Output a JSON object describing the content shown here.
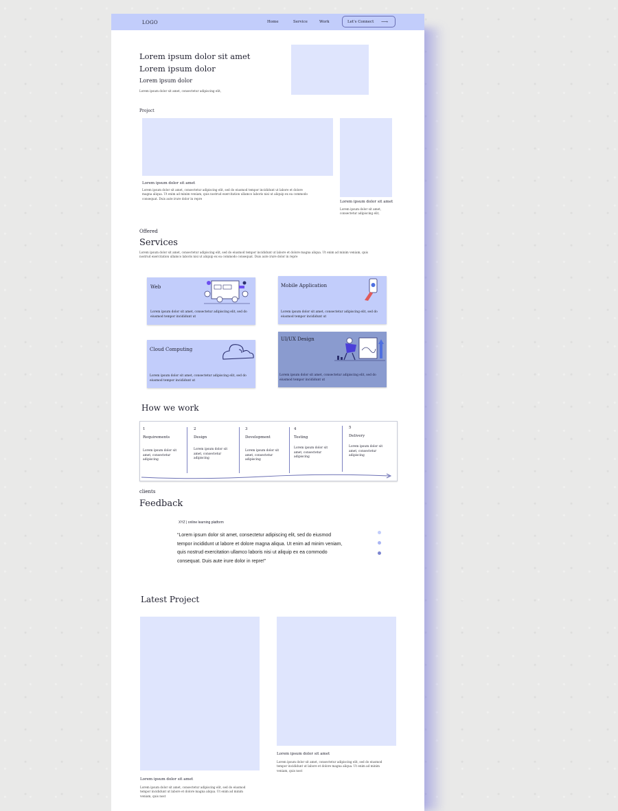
{
  "navbar": {
    "logo": "LOGO",
    "links": [
      "Home",
      "Service",
      "Work"
    ],
    "cta_label": "Let's  Connect",
    "cta_icon": "long-arrow-right-icon"
  },
  "hero": {
    "title1": "Lorem ipsum dolor sit amet",
    "title2": "Lorem ipsum dolor",
    "title3": "Lorem ipsum dolor",
    "body": "Lorem ipsum dolor sit amet, consectetur adipiscing elit,"
  },
  "project": {
    "label": "Project",
    "main_title": "Lorem ipsum dolor sit amet",
    "main_body": [
      "Lorem ipsum dolor sit amet, consectetur adipiscing elit, sed do eiusmod tempor incididunt ut labore et dolore",
      "magna aliqua. Ut enim ad minim veniam, quis nostrud exercitation ullamco laboris nisi ut aliquip ex ea commodo",
      "consequat. Duis aute irure dolor in repre"
    ],
    "side_title": "Lorem ipsum dolor sit amet",
    "side_body": [
      "Lorem ipsum dolor sit amet,",
      "consectetur adipiscing elit,"
    ]
  },
  "services": {
    "eyebrow": "Offered",
    "title": "Services",
    "body": [
      "Lorem ipsum dolor sit amet, consectetur adipiscing elit, sed do eiusmod tempor incididunt ut labore et dolore magna aliqua. Ut enim ad minim veniam, quis",
      "nostrud exercitation ullamco laboris nisi ut aliquip ex ea commodo consequat. Duis aute irure dolor in repre"
    ],
    "cards": [
      {
        "title": "Web",
        "desc": [
          "Lorem ipsum dolor sit amet, consectetur adipiscing elit, sed do",
          "eiusmod tempor incididunt ut"
        ],
        "icon": "web-team-illustration-icon"
      },
      {
        "title": "Mobile Application",
        "desc": [
          "Lorem ipsum dolor sit amet, consectetur adipiscing elit, sed do",
          "eiusmod tempor incididunt ut"
        ],
        "icon": "mobile-hand-illustration-icon"
      },
      {
        "title": "Cloud Computing",
        "desc": [
          "Lorem ipsum dolor sit amet, consectetur adipiscing elit, sed do",
          "eiusmod tempor incididunt ut"
        ],
        "icon": "cloud-outline-icon"
      },
      {
        "title": "UI/UX Design",
        "desc": [
          "Lorem ipsum dolor sit amet, consectetur adipiscing elit, sed do",
          "eiusmod tempor incididunt ut"
        ],
        "icon": "designer-illustration-icon"
      }
    ],
    "colors": {
      "card": "#c2cdfb",
      "card_active": "#8a9bcf"
    }
  },
  "how": {
    "title": "How we work",
    "steps": [
      {
        "num": "1",
        "title": "Requirements",
        "desc": [
          "Lorem ipsum dolor sit",
          "amet, consectetur",
          "adipiscing"
        ]
      },
      {
        "num": "2",
        "title": "Design",
        "desc": [
          "Lorem ipsum dolor sit",
          "amet, consectetur",
          "adipiscing"
        ]
      },
      {
        "num": "3",
        "title": "Development",
        "desc": [
          "Lorem ipsum dolor sit",
          "amet, consectetur",
          "adipiscing"
        ]
      },
      {
        "num": "4",
        "title": "Testing",
        "desc": [
          "Lorem ipsum dolor sit",
          "amet, consectetur",
          "adipiscing"
        ]
      },
      {
        "num": "5",
        "title": "Delivery",
        "desc": [
          "Lorem ipsum dolor sit",
          "amet, consectetur",
          "adipiscing"
        ]
      }
    ]
  },
  "feedback": {
    "eyebrow": "clients",
    "title": "Feedback",
    "source": "XYZ | online learning platform",
    "quote": [
      "“Lorem ipsum dolor sit amet, consectetur adipiscing elit, sed do eiusmod",
      "tempor incididunt ut labore et dolore magna aliqua. Ut enim ad minim veniam,",
      "quis nostrud exercitation ullamco laboris nisi ut aliquip ex ea commodo",
      "consequat. Duis aute irure dolor in repre!”"
    ],
    "dot_colors": [
      "#c2cdfb",
      "#aab6f3",
      "#7b84d0"
    ]
  },
  "latest": {
    "title": "Latest Project",
    "items": [
      {
        "title": "Lorem ipsum dolor sit amet",
        "body": [
          "Lorem ipsum dolor sit amet, consectetur adipiscing elit, sed do eiusmod",
          "tempor incididunt ut labore et dolore magna aliqua. Ut enim ad minim",
          "veniam, quis nost"
        ]
      },
      {
        "title": "Lorem ipsum dolor sit amet",
        "body": [
          "Lorem ipsum dolor sit amet, consectetur adipiscing elit, sed do eiusmod",
          "tempor incididunt ut labore et dolore magna aliqua. Ut enim ad minim",
          "veniam, quis nost"
        ]
      }
    ]
  },
  "colors": {
    "navbar": "#c2cdfb",
    "placeholder": "#dfe5fd",
    "accent": "#6a6fb3",
    "shadow": "#7878dc"
  }
}
